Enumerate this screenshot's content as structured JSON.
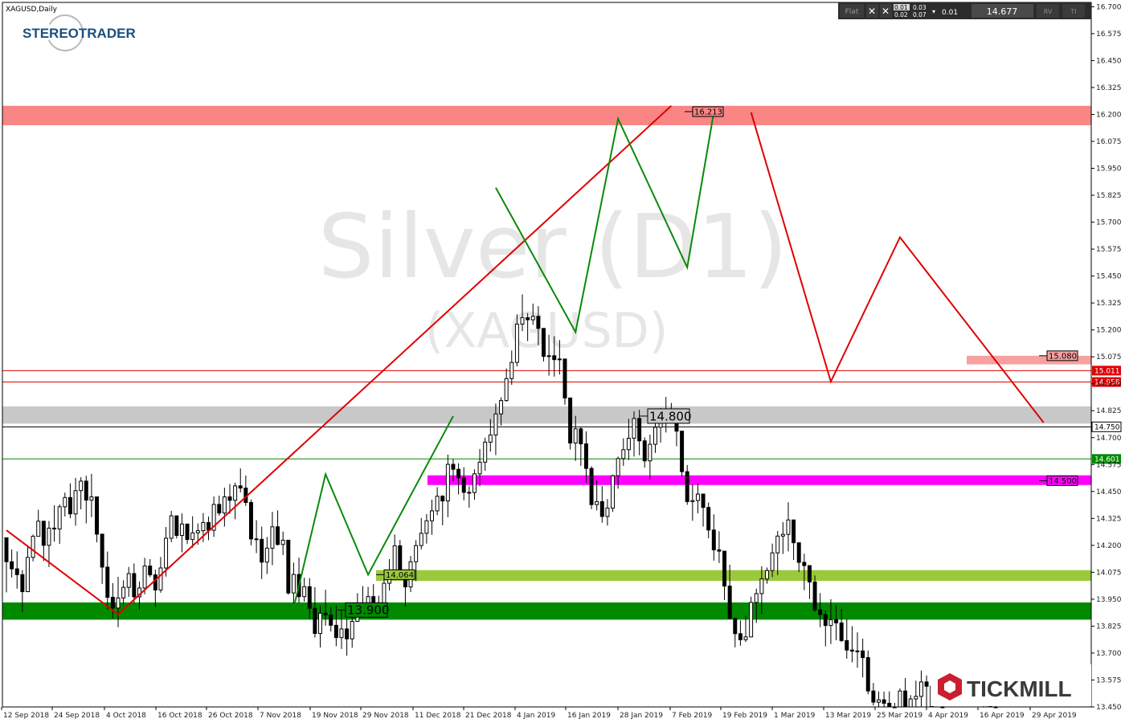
{
  "window": {
    "title": "XAGUSD,Daily",
    "watermark_main": "Silver (D1)",
    "watermark_sub": "(XAGUSD)"
  },
  "branding": {
    "stereotrader": "STEREOTRADER",
    "tickmill": "TICKMILL"
  },
  "trade_panel": {
    "mode": "Flat",
    "bid_lot_top": "0.01",
    "bid_lot_bottom": "0.02",
    "ask_lot_top": "0.03",
    "ask_lot_bottom": "0.07",
    "lot_value": "0.01",
    "price": "14.677",
    "rv_label": "RV",
    "ti_label": "TI"
  },
  "chart_data": {
    "type": "candlestick",
    "symbol": "XAGUSD",
    "timeframe": "Daily",
    "ylim": [
      13.45,
      16.72
    ],
    "y_ticks": [
      "16.700",
      "16.575",
      "16.450",
      "16.325",
      "16.200",
      "16.075",
      "15.950",
      "15.825",
      "15.700",
      "15.575",
      "15.450",
      "15.325",
      "15.200",
      "15.075",
      "14.950",
      "14.825",
      "14.700",
      "14.575",
      "14.450",
      "14.325",
      "14.200",
      "14.075",
      "13.950",
      "13.825",
      "13.700",
      "13.575",
      "13.450"
    ],
    "x_ticks": [
      "12 Sep 2018",
      "24 Sep 2018",
      "4 Oct 2018",
      "16 Oct 2018",
      "26 Oct 2018",
      "7 Nov 2018",
      "19 Nov 2018",
      "29 Nov 2018",
      "11 Dec 2018",
      "21 Dec 2018",
      "4 Jan 2019",
      "16 Jan 2019",
      "28 Jan 2019",
      "7 Feb 2019",
      "19 Feb 2019",
      "1 Mar 2019",
      "13 Mar 2019",
      "25 Mar 2019",
      "4 Apr 2019",
      "16 Apr 2019",
      "29 Apr 2019"
    ],
    "zones": [
      {
        "from": 16.15,
        "to": 16.24,
        "color": "#f98585"
      },
      {
        "from": 14.765,
        "to": 14.845,
        "color": "#c8c8c8"
      },
      {
        "from": 15.04,
        "to": 15.08,
        "color": "#f7a0a0"
      },
      {
        "from": 14.48,
        "to": 14.525,
        "color": "#ff00ff"
      },
      {
        "from": 14.035,
        "to": 14.085,
        "color": "#9ac93b"
      },
      {
        "from": 13.855,
        "to": 13.935,
        "color": "#008a00"
      }
    ],
    "price_labels": [
      {
        "text": "16.213",
        "value": 16.213
      },
      {
        "text": "15.080",
        "value": 15.08
      },
      {
        "text": "14.800",
        "value": 14.8
      },
      {
        "text": "14.500",
        "value": 14.5
      },
      {
        "text": "14.064",
        "value": 14.064
      },
      {
        "text": "13.900",
        "value": 13.9
      }
    ],
    "hlines": [
      {
        "value": 15.011,
        "label": "15.011",
        "color": "#e00000"
      },
      {
        "value": 14.958,
        "label": "14.958",
        "color": "#e00000"
      },
      {
        "value": 14.75,
        "label": "14.750",
        "color": "#000000"
      },
      {
        "value": 14.601,
        "label": "14.601",
        "color": "#008a00"
      }
    ],
    "red_lines": [
      [
        [
          0,
          14.27
        ],
        [
          21,
          13.88
        ],
        [
          125,
          16.24
        ]
      ],
      [
        [
          140,
          16.21
        ],
        [
          155,
          14.96
        ],
        [
          168,
          15.63
        ],
        [
          195,
          14.77
        ]
      ]
    ],
    "green_lines": [
      [
        [
          92,
          15.86
        ],
        [
          107,
          15.19
        ],
        [
          115,
          16.18
        ],
        [
          128,
          15.49
        ],
        [
          133,
          16.21
        ]
      ],
      [
        [
          54,
          13.91
        ],
        [
          60,
          14.53
        ],
        [
          68,
          14.064
        ],
        [
          84,
          14.8
        ]
      ]
    ],
    "candles": [
      [
        14.235,
        14.235,
        13.982,
        14.124
      ],
      [
        14.124,
        14.181,
        14.051,
        14.091
      ],
      [
        14.091,
        14.172,
        13.999,
        14.064
      ],
      [
        14.064,
        14.085,
        13.889,
        13.985
      ],
      [
        13.985,
        14.192,
        13.983,
        14.144
      ],
      [
        14.144,
        14.25,
        14.126,
        14.242
      ],
      [
        14.242,
        14.365,
        14.241,
        14.312
      ],
      [
        14.312,
        14.312,
        14.127,
        14.2
      ],
      [
        14.2,
        14.313,
        14.099,
        14.28
      ],
      [
        14.28,
        14.386,
        14.217,
        14.276
      ],
      [
        14.276,
        14.39,
        14.207,
        14.379
      ],
      [
        14.379,
        14.445,
        14.334,
        14.422
      ],
      [
        14.422,
        14.488,
        14.326,
        14.346
      ],
      [
        14.346,
        14.513,
        14.291,
        14.454
      ],
      [
        14.454,
        14.516,
        14.367,
        14.498
      ],
      [
        14.498,
        14.523,
        14.302,
        14.41
      ],
      [
        14.41,
        14.532,
        14.331,
        14.425
      ],
      [
        14.425,
        14.425,
        14.214,
        14.252
      ],
      [
        14.252,
        14.252,
        14.021,
        14.099
      ],
      [
        14.099,
        14.171,
        13.901,
        13.959
      ],
      [
        13.959,
        14.025,
        13.862,
        13.909
      ],
      [
        13.909,
        14.054,
        13.82,
        13.956
      ],
      [
        13.956,
        14.038,
        13.918,
        14.005
      ],
      [
        14.005,
        14.1,
        13.961,
        14.069
      ],
      [
        14.069,
        14.116,
        13.93,
        13.961
      ],
      [
        13.961,
        14.032,
        13.902,
        14.002
      ],
      [
        14.002,
        14.142,
        13.973,
        14.104
      ],
      [
        14.104,
        14.136,
        14.053,
        14.063
      ],
      [
        14.063,
        14.087,
        13.912,
        13.993
      ],
      [
        13.993,
        14.146,
        13.98,
        14.095
      ],
      [
        14.095,
        14.285,
        14.055,
        14.233
      ],
      [
        14.233,
        14.36,
        14.215,
        14.337
      ],
      [
        14.337,
        14.337,
        14.232,
        14.246
      ],
      [
        14.246,
        14.348,
        14.168,
        14.299
      ],
      [
        14.299,
        14.299,
        14.206,
        14.227
      ],
      [
        14.227,
        14.335,
        14.189,
        14.258
      ],
      [
        14.258,
        14.302,
        14.203,
        14.268
      ],
      [
        14.268,
        14.35,
        14.215,
        14.306
      ],
      [
        14.306,
        14.334,
        14.224,
        14.27
      ],
      [
        14.27,
        14.427,
        14.239,
        14.39
      ],
      [
        14.39,
        14.431,
        14.338,
        14.35
      ],
      [
        14.35,
        14.468,
        14.287,
        14.425
      ],
      [
        14.425,
        14.485,
        14.347,
        14.409
      ],
      [
        14.409,
        14.491,
        14.321,
        14.476
      ],
      [
        14.476,
        14.557,
        14.446,
        14.466
      ],
      [
        14.466,
        14.524,
        14.383,
        14.399
      ],
      [
        14.399,
        14.413,
        14.2,
        14.23
      ],
      [
        14.23,
        14.317,
        14.164,
        14.228
      ],
      [
        14.228,
        14.287,
        14.044,
        14.122
      ],
      [
        14.122,
        14.239,
        14.067,
        14.187
      ],
      [
        14.187,
        14.355,
        14.108,
        14.286
      ],
      [
        14.286,
        14.362,
        14.199,
        14.204
      ],
      [
        14.204,
        14.264,
        14.155,
        14.224
      ],
      [
        14.224,
        14.224,
        13.971,
        13.979
      ],
      [
        13.979,
        14.12,
        13.929,
        14.065
      ],
      [
        14.065,
        14.143,
        13.932,
        13.962
      ],
      [
        13.962,
        14.05,
        13.938,
        14.008
      ],
      [
        14.008,
        14.048,
        13.858,
        13.908
      ],
      [
        13.908,
        14.006,
        13.772,
        13.791
      ],
      [
        13.791,
        13.92,
        13.726,
        13.885
      ],
      [
        13.885,
        13.994,
        13.827,
        13.877
      ],
      [
        13.877,
        13.913,
        13.8,
        13.829
      ],
      [
        13.829,
        13.922,
        13.732,
        13.772
      ],
      [
        13.772,
        13.897,
        13.719,
        13.812
      ],
      [
        13.812,
        13.859,
        13.688,
        13.766
      ],
      [
        13.766,
        13.903,
        13.725,
        13.847
      ],
      [
        13.847,
        13.978,
        13.845,
        13.917
      ],
      [
        13.917,
        14.011,
        13.88,
        13.923
      ],
      [
        13.923,
        14.007,
        13.9,
        13.962
      ],
      [
        13.962,
        14.02,
        13.887,
        13.917
      ],
      [
        13.917,
        13.966,
        13.868,
        13.898
      ],
      [
        13.898,
        14.073,
        13.891,
        14.024
      ],
      [
        14.024,
        14.136,
        13.99,
        14.085
      ],
      [
        14.085,
        14.25,
        14.056,
        14.198
      ],
      [
        14.198,
        14.225,
        14.041,
        14.08
      ],
      [
        14.08,
        14.08,
        13.915,
        14.007
      ],
      [
        14.007,
        14.151,
        13.983,
        14.124
      ],
      [
        14.124,
        14.224,
        14.034,
        14.199
      ],
      [
        14.199,
        14.327,
        14.181,
        14.256
      ],
      [
        14.256,
        14.345,
        14.208,
        14.314
      ],
      [
        14.314,
        14.412,
        14.249,
        14.36
      ],
      [
        14.36,
        14.47,
        14.34,
        14.428
      ],
      [
        14.428,
        14.433,
        14.293,
        14.406
      ],
      [
        14.406,
        14.621,
        14.331,
        14.576
      ],
      [
        14.576,
        14.6,
        14.497,
        14.553
      ],
      [
        14.553,
        14.581,
        14.436,
        14.513
      ],
      [
        14.513,
        14.563,
        14.409,
        14.446
      ],
      [
        14.446,
        14.474,
        14.375,
        14.445
      ],
      [
        14.445,
        14.553,
        14.412,
        14.532
      ],
      [
        14.532,
        14.647,
        14.474,
        14.586
      ],
      [
        14.586,
        14.7,
        14.546,
        14.679
      ],
      [
        14.679,
        14.786,
        14.635,
        14.712
      ],
      [
        14.712,
        14.858,
        14.619,
        14.81
      ],
      [
        14.81,
        14.887,
        14.756,
        14.872
      ],
      [
        14.872,
        15.021,
        14.867,
        14.974
      ],
      [
        14.974,
        15.104,
        14.945,
        15.049
      ],
      [
        15.049,
        15.272,
        15.031,
        15.227
      ],
      [
        15.227,
        15.365,
        15.194,
        15.257
      ],
      [
        15.257,
        15.278,
        15.148,
        15.247
      ],
      [
        15.247,
        15.322,
        15.224,
        15.263
      ],
      [
        15.263,
        15.31,
        15.129,
        15.207
      ],
      [
        15.207,
        15.207,
        15.054,
        15.077
      ],
      [
        15.077,
        15.177,
        14.988,
        15.08
      ],
      [
        15.08,
        15.171,
        14.983,
        15.062
      ],
      [
        15.062,
        15.153,
        14.993,
        15.065
      ],
      [
        15.065,
        15.065,
        14.853,
        14.884
      ],
      [
        14.884,
        14.884,
        14.645,
        14.675
      ],
      [
        14.675,
        14.801,
        14.592,
        14.741
      ],
      [
        14.741,
        14.748,
        14.569,
        14.671
      ],
      [
        14.671,
        14.729,
        14.491,
        14.557
      ],
      [
        14.557,
        14.567,
        14.368,
        14.389
      ],
      [
        14.389,
        14.501,
        14.362,
        14.403
      ],
      [
        14.403,
        14.475,
        14.305,
        14.334
      ],
      [
        14.334,
        14.415,
        14.292,
        14.373
      ],
      [
        14.373,
        14.528,
        14.355,
        14.523
      ],
      [
        14.523,
        14.612,
        14.463,
        14.603
      ],
      [
        14.603,
        14.697,
        14.569,
        14.644
      ],
      [
        14.644,
        14.787,
        14.596,
        14.697
      ],
      [
        14.697,
        14.822,
        14.612,
        14.789
      ],
      [
        14.789,
        14.829,
        14.618,
        14.685
      ],
      [
        14.685,
        14.701,
        14.561,
        14.592
      ],
      [
        14.592,
        14.714,
        14.505,
        14.669
      ],
      [
        14.669,
        14.813,
        14.629,
        14.748
      ],
      [
        14.748,
        14.837,
        14.677,
        14.808
      ],
      [
        14.808,
        14.889,
        14.724,
        14.809
      ],
      [
        14.809,
        14.861,
        14.786,
        14.79
      ],
      [
        14.79,
        14.802,
        14.66,
        14.73
      ],
      [
        14.73,
        14.73,
        14.52,
        14.542
      ],
      [
        14.542,
        14.573,
        14.388,
        14.403
      ],
      [
        14.403,
        14.484,
        14.314,
        14.408
      ],
      [
        14.408,
        14.488,
        14.349,
        14.438
      ],
      [
        14.438,
        14.438,
        14.287,
        14.376
      ],
      [
        14.376,
        14.399,
        14.233,
        14.271
      ],
      [
        14.271,
        14.344,
        14.129,
        14.179
      ],
      [
        14.179,
        14.265,
        14.118,
        14.173
      ],
      [
        14.173,
        14.173,
        13.946,
        14.011
      ],
      [
        14.011,
        14.11,
        13.857,
        13.861
      ],
      [
        13.861,
        13.861,
        13.727,
        13.79
      ],
      [
        13.79,
        13.852,
        13.734,
        13.762
      ],
      [
        13.762,
        13.874,
        13.751,
        13.775
      ],
      [
        13.775,
        13.962,
        13.773,
        13.935
      ],
      [
        13.935,
        13.999,
        13.84,
        13.976
      ],
      [
        13.976,
        14.103,
        13.882,
        14.044
      ],
      [
        14.044,
        14.097,
        14.022,
        14.083
      ],
      [
        14.083,
        14.208,
        14.052,
        14.165
      ],
      [
        14.165,
        14.267,
        14.062,
        14.243
      ],
      [
        14.243,
        14.308,
        14.16,
        14.251
      ],
      [
        14.251,
        14.4,
        14.172,
        14.318
      ],
      [
        14.318,
        14.318,
        14.132,
        14.212
      ],
      [
        14.212,
        14.212,
        14.076,
        14.121
      ],
      [
        14.121,
        14.161,
        13.992,
        14.106
      ],
      [
        14.106,
        14.106,
        13.951,
        14.03
      ],
      [
        14.03,
        14.06,
        13.891,
        13.901
      ],
      [
        13.901,
        13.978,
        13.82,
        13.879
      ],
      [
        13.879,
        13.898,
        13.731,
        13.828
      ],
      [
        13.828,
        13.95,
        13.742,
        13.855
      ],
      [
        13.855,
        13.922,
        13.76,
        13.84
      ],
      [
        13.84,
        13.905,
        13.751,
        13.758
      ],
      [
        13.758,
        13.858,
        13.674,
        13.714
      ],
      [
        13.714,
        13.825,
        13.657,
        13.709
      ],
      [
        13.709,
        13.796,
        13.632,
        13.71
      ],
      [
        13.71,
        13.767,
        13.587,
        13.679
      ],
      [
        13.679,
        13.712,
        13.509,
        13.524
      ],
      [
        13.524,
        13.561,
        13.457,
        13.472
      ],
      [
        13.472,
        13.522,
        13.45,
        13.483
      ],
      [
        13.483,
        13.521,
        13.45,
        13.467
      ],
      [
        13.467,
        13.522,
        13.45,
        13.45
      ],
      [
        13.45,
        13.469,
        13.45,
        13.45
      ],
      [
        13.45,
        13.536,
        13.45,
        13.524
      ],
      [
        13.524,
        13.584,
        13.45,
        13.45
      ],
      [
        13.45,
        13.505,
        13.45,
        13.487
      ],
      [
        13.487,
        13.572,
        13.45,
        13.499
      ],
      [
        13.499,
        13.619,
        13.45,
        13.566
      ],
      [
        13.566,
        13.596,
        13.45,
        13.546
      ],
      [
        13.546,
        13.546,
        13.45,
        13.45
      ],
      [
        13.45,
        13.45,
        13.45,
        13.45
      ],
      [
        13.45,
        13.52,
        13.45,
        13.45
      ],
      [
        13.45,
        13.45,
        13.45,
        13.45
      ],
      [
        13.45,
        13.45,
        13.45,
        13.45
      ],
      [
        13.45,
        13.45,
        13.45,
        13.45
      ],
      [
        13.45,
        13.45,
        13.45,
        13.45
      ],
      [
        13.45,
        13.45,
        13.45,
        13.45
      ],
      [
        13.45,
        13.45,
        13.45,
        13.45
      ],
      [
        13.45,
        13.45,
        13.45,
        13.45
      ],
      [
        13.45,
        13.549,
        13.45,
        13.521
      ],
      [
        13.521,
        13.521,
        13.45,
        13.45
      ],
      [
        13.45,
        13.465,
        13.45,
        13.45
      ],
      [
        13.45,
        13.45,
        13.45,
        13.45
      ],
      [
        13.45,
        13.45,
        13.45,
        13.45
      ],
      [
        13.45,
        13.45,
        13.45,
        13.45
      ],
      [
        13.45,
        13.45,
        13.45,
        13.45
      ],
      [
        13.45,
        13.45,
        13.45,
        13.45
      ],
      [
        13.45,
        13.45,
        13.45,
        13.45
      ],
      [
        13.45,
        13.45,
        13.45,
        13.45
      ],
      [
        13.45,
        13.45,
        13.45,
        13.45
      ],
      [
        13.45,
        13.45,
        13.45,
        13.45
      ],
      [
        13.45,
        13.45,
        13.45,
        13.45
      ],
      [
        13.45,
        13.45,
        13.45,
        13.45
      ],
      [
        13.45,
        13.45,
        13.45,
        13.45
      ],
      [
        13.45,
        13.45,
        13.45,
        13.45
      ],
      [
        13.45,
        13.45,
        13.45,
        13.45
      ],
      [
        13.45,
        13.45,
        13.45,
        13.45
      ],
      [
        13.45,
        13.45,
        13.45,
        13.45
      ]
    ]
  }
}
